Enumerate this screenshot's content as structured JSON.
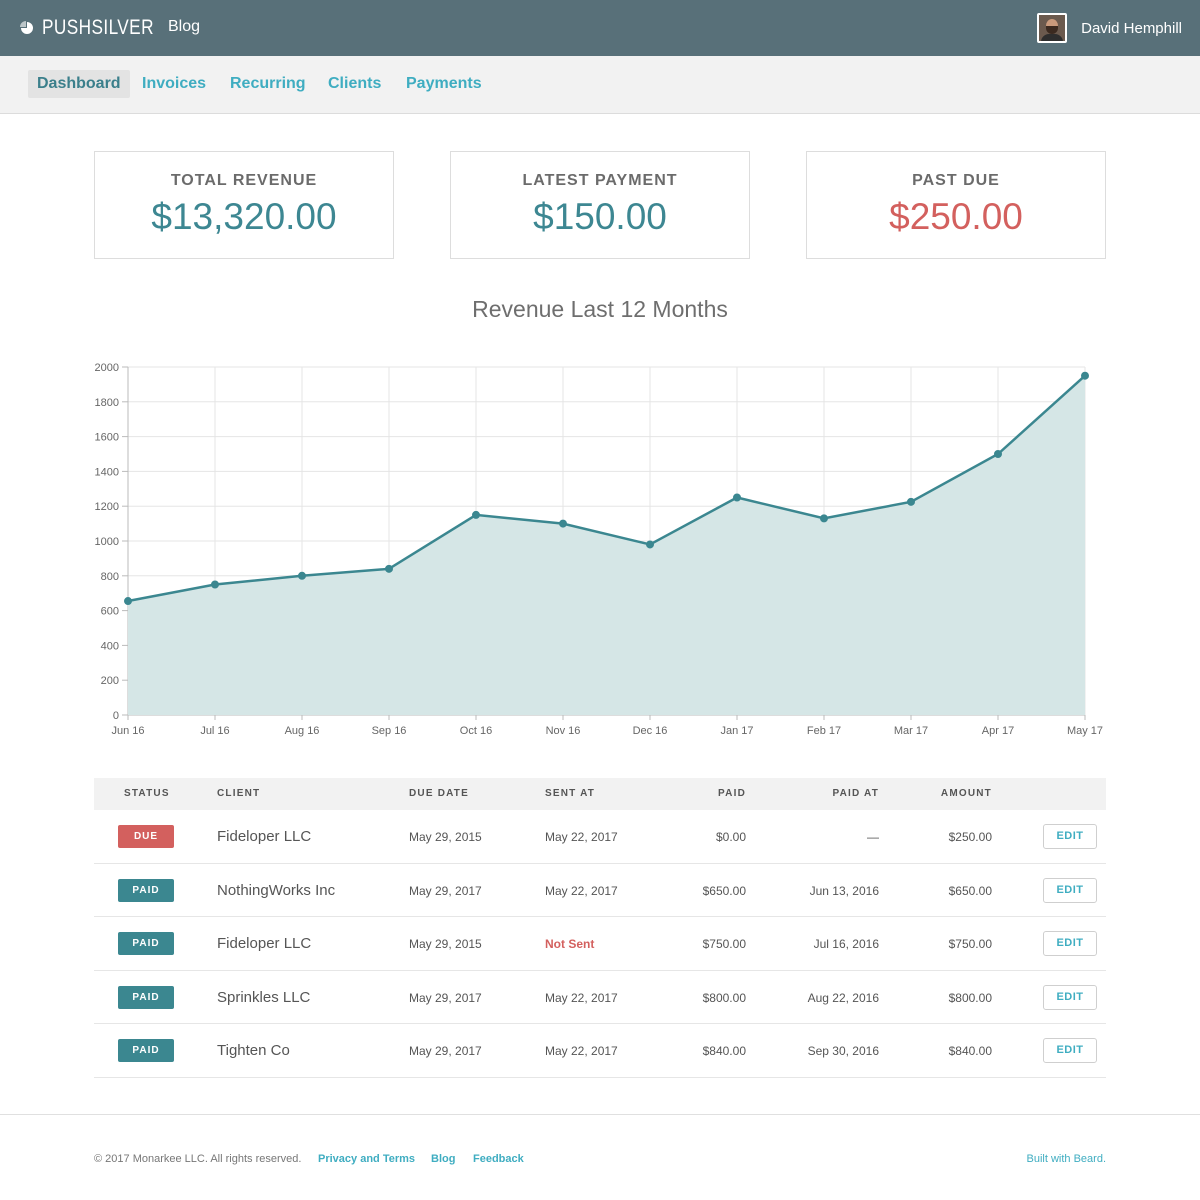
{
  "topbar": {
    "logo_text": "PUSHSILVER",
    "logo_icon": "pie-icon",
    "blog_label": "Blog",
    "user_name": "David Hemphill",
    "bg_color": "#587079"
  },
  "nav": {
    "items": [
      {
        "label": "Dashboard",
        "active": true
      },
      {
        "label": "Invoices",
        "active": false
      },
      {
        "label": "Recurring",
        "active": false
      },
      {
        "label": "Clients",
        "active": false
      },
      {
        "label": "Payments",
        "active": false
      }
    ],
    "accent_color": "#3fadc1"
  },
  "stats": [
    {
      "label": "TOTAL REVENUE",
      "value": "$13,320.00",
      "color": "#3d8792"
    },
    {
      "label": "LATEST PAYMENT",
      "value": "$150.00",
      "color": "#3d8792"
    },
    {
      "label": "PAST DUE",
      "value": "$250.00",
      "color": "#d3605e"
    }
  ],
  "chart_title": "Revenue Last 12 Months",
  "chart_data": {
    "type": "area",
    "title": "Revenue Last 12 Months",
    "categories": [
      "Jun 16",
      "Jul 16",
      "Aug 16",
      "Sep 16",
      "Oct 16",
      "Nov 16",
      "Dec 16",
      "Jan 17",
      "Feb 17",
      "Mar 17",
      "Apr 17",
      "May 17"
    ],
    "series": [
      {
        "values": [
          655,
          750,
          800,
          840,
          1150,
          1100,
          980,
          1250,
          1130,
          1225,
          1500,
          1950
        ]
      }
    ],
    "ylim": [
      0,
      2000
    ],
    "yticks": [
      0,
      200,
      400,
      600,
      800,
      1000,
      1200,
      1400,
      1600,
      1800,
      2000
    ],
    "grid": true,
    "line_color": "#3b8790",
    "fill_color": "#d5e6e6"
  },
  "table": {
    "headers": [
      "STATUS",
      "CLIENT",
      "DUE DATE",
      "SENT AT",
      "PAID",
      "PAID AT",
      "AMOUNT"
    ],
    "edit_label": "EDIT",
    "rows": [
      {
        "status": "DUE",
        "client": "Fideloper LLC",
        "due_date": "May 29, 2015",
        "sent_at": "May 22, 2017",
        "paid": "$0.00",
        "paid_at": "—",
        "amount": "$250.00"
      },
      {
        "status": "PAID",
        "client": "NothingWorks Inc",
        "due_date": "May 29, 2017",
        "sent_at": "May 22, 2017",
        "paid": "$650.00",
        "paid_at": "Jun 13, 2016",
        "amount": "$650.00"
      },
      {
        "status": "PAID",
        "client": "Fideloper LLC",
        "due_date": "May 29, 2015",
        "sent_at": "Not Sent",
        "paid": "$750.00",
        "paid_at": "Jul 16, 2016",
        "amount": "$750.00"
      },
      {
        "status": "PAID",
        "client": "Sprinkles LLC",
        "due_date": "May 29, 2017",
        "sent_at": "May 22, 2017",
        "paid": "$800.00",
        "paid_at": "Aug 22, 2016",
        "amount": "$800.00"
      },
      {
        "status": "PAID",
        "client": "Tighten Co",
        "due_date": "May 29, 2017",
        "sent_at": "May 22, 2017",
        "paid": "$840.00",
        "paid_at": "Sep 30, 2016",
        "amount": "$840.00"
      }
    ]
  },
  "footer": {
    "copyright": "© 2017 Monarkee LLC. All rights reserved.",
    "links": [
      "Privacy and Terms",
      "Blog",
      "Feedback"
    ],
    "built_with": "Built with Beard."
  }
}
